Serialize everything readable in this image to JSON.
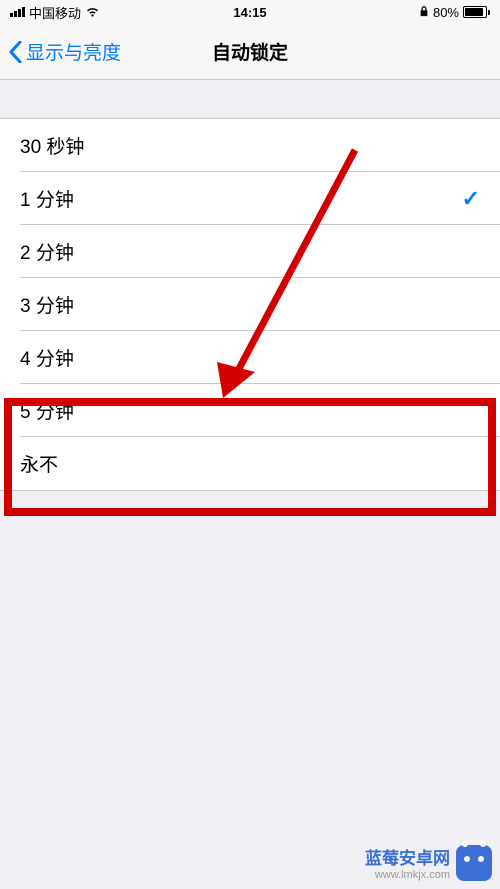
{
  "status": {
    "carrier": "中国移动",
    "time": "14:15",
    "battery_pct": "80%"
  },
  "nav": {
    "back_label": "显示与亮度",
    "title": "自动锁定"
  },
  "options": [
    {
      "label": "30 秒钟",
      "selected": false
    },
    {
      "label": "1 分钟",
      "selected": true
    },
    {
      "label": "2 分钟",
      "selected": false
    },
    {
      "label": "3 分钟",
      "selected": false
    },
    {
      "label": "4 分钟",
      "selected": false
    },
    {
      "label": "5 分钟",
      "selected": false
    },
    {
      "label": "永不",
      "selected": false
    }
  ],
  "watermark": {
    "title": "蓝莓安卓网",
    "url": "www.lmkjx.com"
  }
}
